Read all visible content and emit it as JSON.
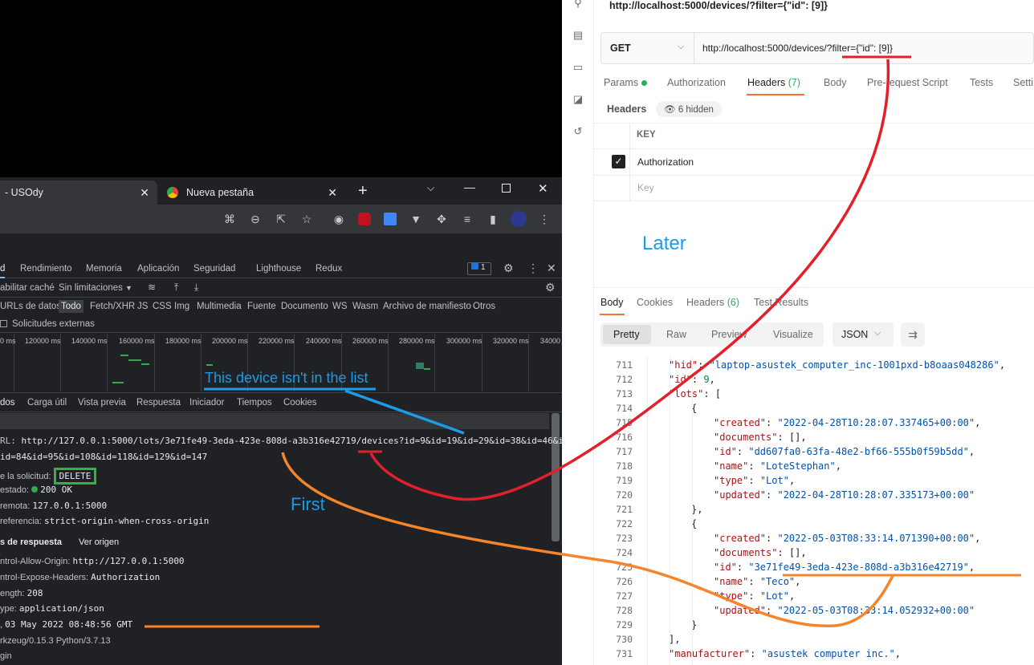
{
  "postman": {
    "request_title": "http://localhost:5000/devices/?filter={\"id\": [9]}",
    "method": "GET",
    "url": "http://localhost:5000/devices/?filter={\"id\": [9]}",
    "request_tabs": [
      {
        "label": "Params"
      },
      {
        "label": "Authorization"
      },
      {
        "label": "Headers",
        "count": "(7)"
      },
      {
        "label": "Body"
      },
      {
        "label": "Pre-request Script"
      },
      {
        "label": "Tests"
      },
      {
        "label": "Setti"
      }
    ],
    "headers_label": "Headers",
    "hidden_count": "6 hidden",
    "key_column": "KEY",
    "header_rows": [
      "Authorization"
    ],
    "key_placeholder": "Key",
    "response_tabs": [
      {
        "label": "Body"
      },
      {
        "label": "Cookies"
      },
      {
        "label": "Headers",
        "count": "(6)"
      },
      {
        "label": "Test Results"
      }
    ],
    "view_modes": [
      "Pretty",
      "Raw",
      "Preview",
      "Visualize"
    ],
    "format": "JSON",
    "code_lines": [
      {
        "n": "711",
        "indent": 1,
        "key": "hid",
        "val": "laptop-asustek_computer_inc-1001pxd-b8oaas048286",
        "t": "s",
        "comma": ","
      },
      {
        "n": "712",
        "indent": 1,
        "key": "id",
        "val": "9",
        "t": "n",
        "comma": ","
      },
      {
        "n": "713",
        "indent": 1,
        "key": "lots",
        "val": "[",
        "t": "p",
        "comma": ""
      },
      {
        "n": "714",
        "indent": 2,
        "key": "",
        "val": "{",
        "t": "p",
        "comma": ""
      },
      {
        "n": "715",
        "indent": 3,
        "key": "created",
        "val": "2022-04-28T10:28:07.337465+00:00",
        "t": "s",
        "comma": ","
      },
      {
        "n": "716",
        "indent": 3,
        "key": "documents",
        "val": "[]",
        "t": "p",
        "comma": ","
      },
      {
        "n": "717",
        "indent": 3,
        "key": "id",
        "val": "dd607fa0-63fa-48e2-bf66-555b0f59b5dd",
        "t": "s",
        "comma": ","
      },
      {
        "n": "718",
        "indent": 3,
        "key": "name",
        "val": "LoteStephan",
        "t": "s",
        "comma": ","
      },
      {
        "n": "719",
        "indent": 3,
        "key": "type",
        "val": "Lot",
        "t": "s",
        "comma": ","
      },
      {
        "n": "720",
        "indent": 3,
        "key": "updated",
        "val": "2022-04-28T10:28:07.335173+00:00",
        "t": "s",
        "comma": ""
      },
      {
        "n": "721",
        "indent": 2,
        "key": "",
        "val": "},",
        "t": "p",
        "comma": ""
      },
      {
        "n": "722",
        "indent": 2,
        "key": "",
        "val": "{",
        "t": "p",
        "comma": ""
      },
      {
        "n": "723",
        "indent": 3,
        "key": "created",
        "val": "2022-05-03T08:33:14.071390+00:00",
        "t": "s",
        "comma": ","
      },
      {
        "n": "724",
        "indent": 3,
        "key": "documents",
        "val": "[]",
        "t": "p",
        "comma": ","
      },
      {
        "n": "725",
        "indent": 3,
        "key": "id",
        "val": "3e71fe49-3eda-423e-808d-a3b316e42719",
        "t": "s",
        "comma": ","
      },
      {
        "n": "726",
        "indent": 3,
        "key": "name",
        "val": "Teco",
        "t": "s",
        "comma": ","
      },
      {
        "n": "727",
        "indent": 3,
        "key": "type",
        "val": "Lot",
        "t": "s",
        "comma": ","
      },
      {
        "n": "728",
        "indent": 3,
        "key": "updated",
        "val": "2022-05-03T08:33:14.052932+00:00",
        "t": "s",
        "comma": ""
      },
      {
        "n": "729",
        "indent": 2,
        "key": "",
        "val": "}",
        "t": "p",
        "comma": ""
      },
      {
        "n": "730",
        "indent": 1,
        "key": "",
        "val": "],",
        "t": "p",
        "comma": ""
      },
      {
        "n": "731",
        "indent": 1,
        "key": "manufacturer",
        "val": "asustek computer inc.",
        "t": "s",
        "comma": ","
      }
    ]
  },
  "chrome": {
    "tabs": [
      {
        "label": "- USOdy"
      },
      {
        "label": "Nueva pestaña"
      }
    ],
    "devtools_tabs": [
      "d",
      "Rendimiento",
      "Memoria",
      "Aplicación",
      "Seguridad",
      "Lighthouse",
      "Redux"
    ],
    "issues_count": "1",
    "network_bar": {
      "cache": "abilitar caché",
      "throttle": "Sin limitaciones"
    },
    "filters": [
      "URLs de datos",
      "Todo",
      "Fetch/XHR",
      "JS",
      "CSS",
      "Img",
      "Multimedia",
      "Fuente",
      "Documento",
      "WS",
      "Wasm",
      "Archivo de manifiesto",
      "Otros"
    ],
    "external_requests": "Solicitudes externas",
    "timeline_ticks": [
      "0 ms",
      "120000 ms",
      "140000 ms",
      "160000 ms",
      "180000 ms",
      "200000 ms",
      "220000 ms",
      "240000 ms",
      "260000 ms",
      "280000 ms",
      "300000 ms",
      "320000 ms",
      "34000"
    ],
    "detail_tabs": [
      "dos",
      "Carga útil",
      "Vista previa",
      "Respuesta",
      "Iniciador",
      "Tiempos",
      "Cookies"
    ],
    "general": {
      "url_label": "RL:",
      "url_value": "http://127.0.0.1:5000/lots/3e71fe49-3eda-423e-808d-a3b316e42719/devices?id=9&id=19&id=29&id=38&id=46&id=56&id=6",
      "url_value_2": "id=84&id=95&id=108&id=118&id=129&id=147",
      "method_label": "e la solicitud:",
      "method_value": "DELETE",
      "status_label": "estado:",
      "status_value": "200 OK",
      "remote_label": "remota:",
      "remote_value": "127.0.0.1:5000",
      "referrer_label": "referencia:",
      "referrer_value": "strict-origin-when-cross-origin"
    },
    "response_headers_title": "s de respuesta",
    "view_source": "Ver origen",
    "response_headers": [
      {
        "k": "ntrol-Allow-Origin:",
        "v": "http://127.0.0.1:5000"
      },
      {
        "k": "ntrol-Expose-Headers:",
        "v": "Authorization"
      },
      {
        "k": "ength:",
        "v": "208"
      },
      {
        "k": "ype:",
        "v": "application/json"
      },
      {
        "k": ",",
        "v": "03 May 2022 08:48:56 GMT"
      },
      {
        "k": "rkzeug/0.15.3 Python/3.7.13",
        "v": ""
      },
      {
        "k": "gin",
        "v": ""
      }
    ]
  },
  "annotations": {
    "later": "Later",
    "first": "First",
    "not_in_list": "This device isn't in the list"
  },
  "colors": {
    "postman_orange": "#ff6c37",
    "annotation_red": "#e3202a",
    "annotation_orange": "#f5842a",
    "annotation_blue": "#1c9be6",
    "annotation_green": "#2fb344",
    "chrome_dark": "#202124"
  }
}
